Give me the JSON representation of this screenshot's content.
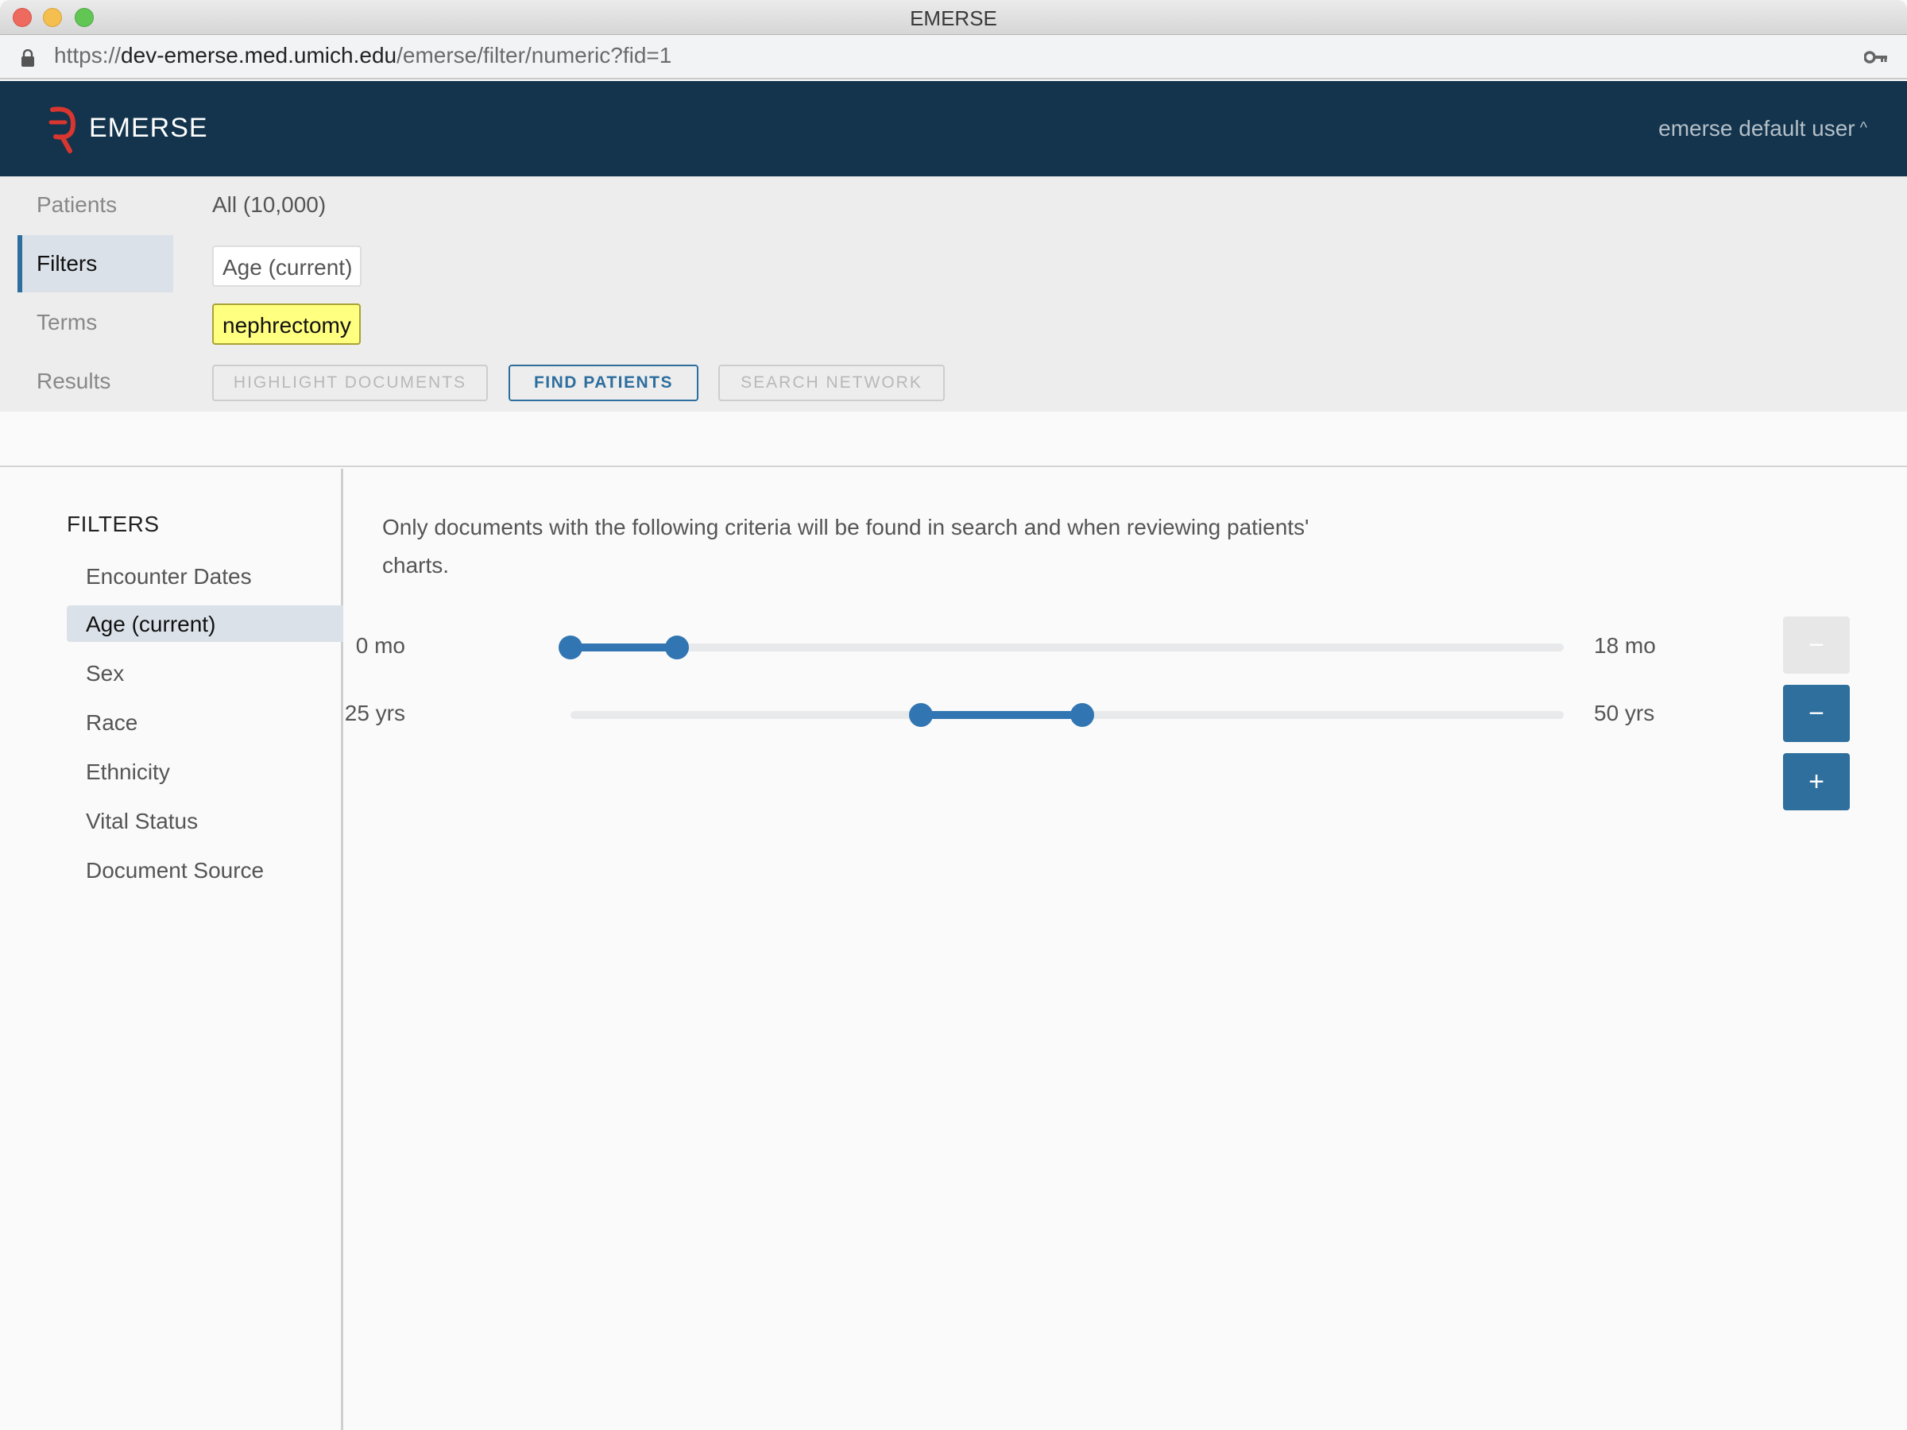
{
  "window": {
    "title": "EMERSE"
  },
  "browser": {
    "url_scheme": "https://",
    "url_host": "dev-emerse.med.umich.edu",
    "url_path": "/emerse/filter/numeric?fid=1"
  },
  "header": {
    "brand": "EMERSE",
    "user": "emerse default user",
    "user_caret": "^"
  },
  "summary": {
    "rows": [
      {
        "label": "Patients",
        "value": "All (10,000)"
      },
      {
        "label": "Filters",
        "value": "Age (current)"
      },
      {
        "label": "Terms",
        "value": "nephrectomy"
      },
      {
        "label": "Results"
      }
    ],
    "buttons": {
      "highlight": "HIGHLIGHT DOCUMENTS",
      "find": "FIND PATIENTS",
      "network": "SEARCH NETWORK"
    }
  },
  "sidebar": {
    "heading": "FILTERS",
    "items": [
      {
        "label": "Encounter Dates"
      },
      {
        "label": "Age (current)",
        "active": true
      },
      {
        "label": "Sex"
      },
      {
        "label": "Race"
      },
      {
        "label": "Ethnicity"
      },
      {
        "label": "Vital Status"
      },
      {
        "label": "Document Source"
      }
    ]
  },
  "main": {
    "description": "Only documents with the following criteria will be found in search and when reviewing patients' charts.",
    "ranges": [
      {
        "min_label": "0 mo",
        "max_label": "18 mo",
        "low_fraction": 0.0,
        "high_fraction": 0.107
      },
      {
        "min_label": "25 yrs",
        "max_label": "50 yrs",
        "low_fraction": 0.353,
        "high_fraction": 0.515
      }
    ],
    "buttons": {
      "remove_first": "−",
      "remove_second": "−",
      "add": "+"
    }
  },
  "colors": {
    "header_bg": "#13344c",
    "accent": "#2e6f9e",
    "slider": "#3176b2",
    "term_highlight": "#ffff80",
    "logo": "#d9362f"
  }
}
